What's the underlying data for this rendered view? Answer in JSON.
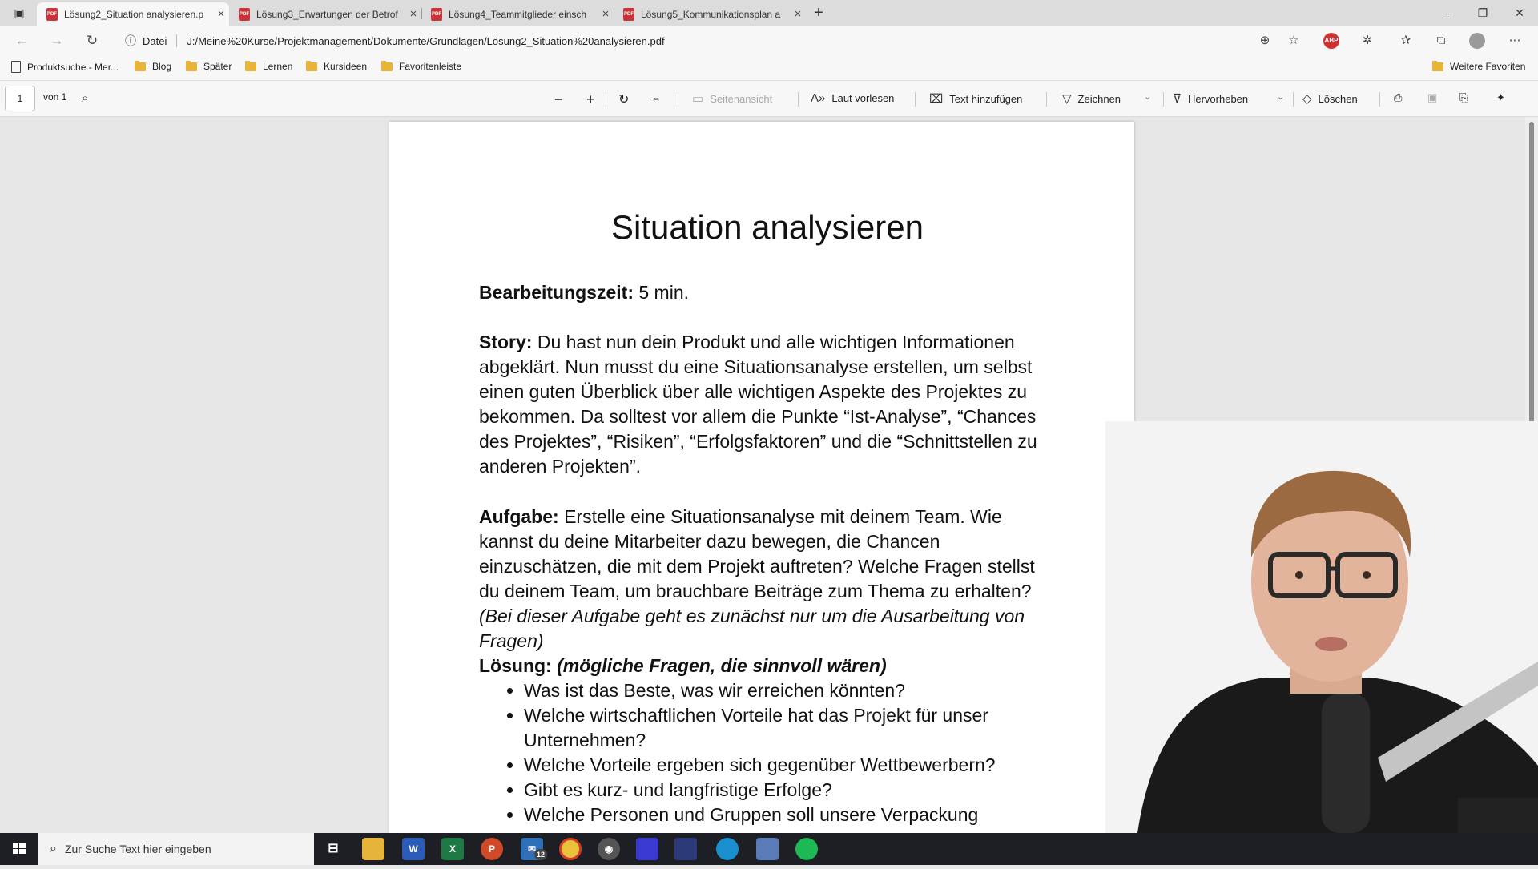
{
  "tabs": [
    {
      "label": "Lösung2_Situation analysieren.p",
      "active": true
    },
    {
      "label": "Lösung3_Erwartungen der Betrof",
      "active": false
    },
    {
      "label": "Lösung4_Teammitglieder einsch",
      "active": false
    },
    {
      "label": "Lösung5_Kommunikationsplan a",
      "active": false
    }
  ],
  "address": {
    "scheme_label": "Datei",
    "url": "J:/Meine%20Kurse/Projektmanagement/Dokumente/Grundlagen/Lösung2_Situation%20analysieren.pdf"
  },
  "extension_badge": "ABP",
  "favorites": {
    "items": [
      "Produktsuche - Mer...",
      "Blog",
      "Später",
      "Lernen",
      "Kursideen",
      "Favoritenleiste"
    ],
    "more": "Weitere Favoriten"
  },
  "pdf_toolbar": {
    "page_number": "1",
    "page_total": "von 1",
    "page_view": "Seitenansicht",
    "read_aloud": "Laut vorlesen",
    "add_text": "Text hinzufügen",
    "draw": "Zeichnen",
    "highlight": "Hervorheben",
    "erase": "Löschen"
  },
  "document": {
    "title": "Situation analysieren",
    "time_label": "Bearbeitungszeit:",
    "time_value": "5 min.",
    "story_label": "Story:",
    "story_text": "Du hast nun dein Produkt und alle wichtigen Informationen abgeklärt. Nun musst du eine Situationsanalyse erstellen, um selbst einen guten Überblick über alle wichtigen Aspekte des Projektes zu bekommen. Da solltest vor allem die Punkte “Ist-Analyse”, “Chances des Projektes”, “Risiken”, “Erfolgsfaktoren” und die “Schnittstellen zu anderen Projekten”.",
    "task_label": "Aufgabe:",
    "task_text": "Erstelle eine Situationsanalyse mit deinem Team. Wie kannst du deine Mitarbeiter dazu bewegen, die Chancen einzuschätzen, die mit dem Projekt auftreten? Welche Fragen stellst du deinem Team, um brauchbare Beiträge zum Thema zu erhalten?",
    "task_note": "(Bei dieser Aufgabe geht es zunächst nur um die Ausarbeitung von Fragen)",
    "solution_label": "Lösung:",
    "solution_note": "(mögliche Fragen, die sinnvoll wären)",
    "solutions": [
      "Was ist das Beste, was wir erreichen könnten?",
      "Welche wirtschaftlichen Vorteile hat das Projekt für unser Unternehmen?",
      "Welche Vorteile ergeben sich gegenüber Wettbewerbern?",
      "Gibt es kurz- und langfristige Erfolge?",
      "Welche Personen und Gruppen soll unsere Verpackung"
    ]
  },
  "taskbar": {
    "search_placeholder": "Zur Suche Text hier eingeben",
    "mail_badge": "12"
  }
}
